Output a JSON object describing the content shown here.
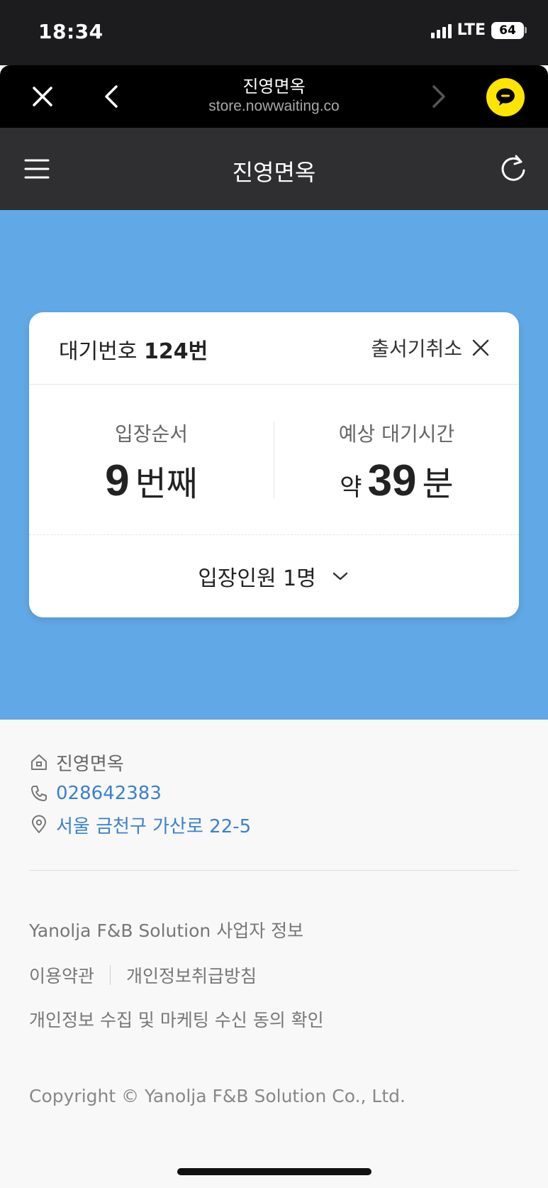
{
  "status": {
    "time": "18:34",
    "network": "LTE",
    "battery": "64"
  },
  "browser": {
    "title": "진영면옥",
    "url": "store.nowwaiting.co"
  },
  "header": {
    "title": "진영면옥"
  },
  "card": {
    "wait_label": "대기번호",
    "wait_number": "124번",
    "cancel_label": "출서기취소",
    "order": {
      "label": "입장순서",
      "value": "9",
      "unit": "번째"
    },
    "eta": {
      "label": "예상 대기시간",
      "prefix": "약",
      "value": "39",
      "unit": "분"
    },
    "party_label": "입장인원 1명"
  },
  "store": {
    "name": "진영면옥",
    "phone": "028642383",
    "address": "서울 금천구 가산로 22-5"
  },
  "footer": {
    "business_info": "Yanolja F&B Solution 사업자 정보",
    "terms": "이용약관",
    "privacy": "개인정보취급방침",
    "consent": "개인정보 수집 및 마케팅 수신 동의 확인",
    "copyright": "Copyright © Yanolja F&B Solution Co., Ltd."
  },
  "colors": {
    "accent": "#61a8e6",
    "link": "#3b80cf",
    "kakao": "#fee500"
  }
}
